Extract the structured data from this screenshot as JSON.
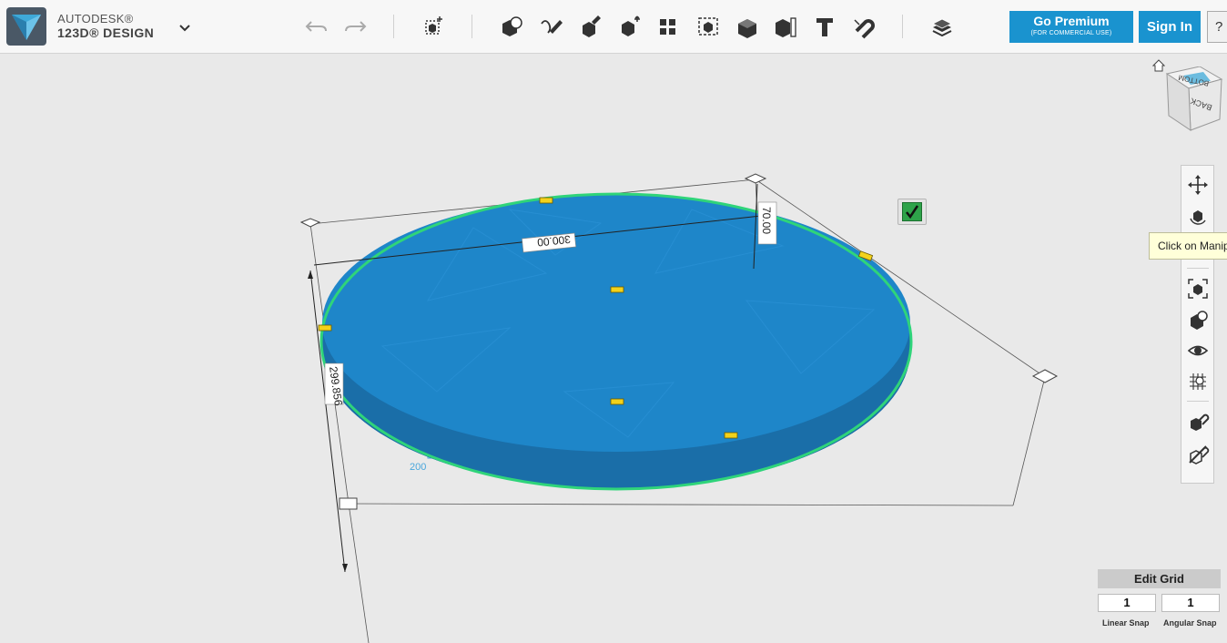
{
  "app": {
    "brand_line1": "AUTODESK®",
    "brand_line2": "123D® DESIGN",
    "accent": "#1a93cf"
  },
  "toolbar": {
    "undo_icon": "undo-icon",
    "redo_icon": "redo-icon",
    "tools": [
      "transform",
      "primitives",
      "sketch",
      "construct",
      "modify",
      "pattern",
      "grouping",
      "combine",
      "measure",
      "text",
      "snap",
      "material"
    ],
    "premium_label": "Go Premium",
    "premium_sub": "(FOR COMMERCIAL USE)",
    "signin_label": "Sign In",
    "help_label": "?"
  },
  "viewport": {
    "dim_diameter": "300.00",
    "dim_height": "70.00",
    "dim_depth": "299.856",
    "grid_number": "200",
    "object_color": "#1e86c9",
    "selection_color": "#2fd47a"
  },
  "navigation": {
    "viewcube_top": "BOTTOM",
    "viewcube_front": "BACK",
    "tooltip": "Click on Manipulate"
  },
  "grid": {
    "title": "Edit Grid",
    "linear_value": "1",
    "angular_value": "1",
    "linear_label": "Linear Snap",
    "angular_label": "Angular Snap"
  }
}
